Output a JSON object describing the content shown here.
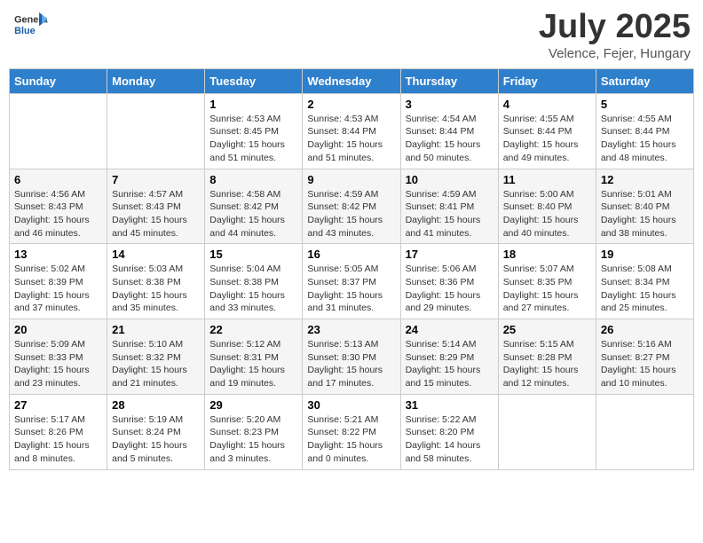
{
  "header": {
    "logo_general": "General",
    "logo_blue": "Blue",
    "title": "July 2025",
    "location": "Velence, Fejer, Hungary"
  },
  "weekdays": [
    "Sunday",
    "Monday",
    "Tuesday",
    "Wednesday",
    "Thursday",
    "Friday",
    "Saturday"
  ],
  "weeks": [
    [
      {
        "day": "",
        "sunrise": "",
        "sunset": "",
        "daylight": ""
      },
      {
        "day": "",
        "sunrise": "",
        "sunset": "",
        "daylight": ""
      },
      {
        "day": "1",
        "sunrise": "Sunrise: 4:53 AM",
        "sunset": "Sunset: 8:45 PM",
        "daylight": "Daylight: 15 hours and 51 minutes."
      },
      {
        "day": "2",
        "sunrise": "Sunrise: 4:53 AM",
        "sunset": "Sunset: 8:44 PM",
        "daylight": "Daylight: 15 hours and 51 minutes."
      },
      {
        "day": "3",
        "sunrise": "Sunrise: 4:54 AM",
        "sunset": "Sunset: 8:44 PM",
        "daylight": "Daylight: 15 hours and 50 minutes."
      },
      {
        "day": "4",
        "sunrise": "Sunrise: 4:55 AM",
        "sunset": "Sunset: 8:44 PM",
        "daylight": "Daylight: 15 hours and 49 minutes."
      },
      {
        "day": "5",
        "sunrise": "Sunrise: 4:55 AM",
        "sunset": "Sunset: 8:44 PM",
        "daylight": "Daylight: 15 hours and 48 minutes."
      }
    ],
    [
      {
        "day": "6",
        "sunrise": "Sunrise: 4:56 AM",
        "sunset": "Sunset: 8:43 PM",
        "daylight": "Daylight: 15 hours and 46 minutes."
      },
      {
        "day": "7",
        "sunrise": "Sunrise: 4:57 AM",
        "sunset": "Sunset: 8:43 PM",
        "daylight": "Daylight: 15 hours and 45 minutes."
      },
      {
        "day": "8",
        "sunrise": "Sunrise: 4:58 AM",
        "sunset": "Sunset: 8:42 PM",
        "daylight": "Daylight: 15 hours and 44 minutes."
      },
      {
        "day": "9",
        "sunrise": "Sunrise: 4:59 AM",
        "sunset": "Sunset: 8:42 PM",
        "daylight": "Daylight: 15 hours and 43 minutes."
      },
      {
        "day": "10",
        "sunrise": "Sunrise: 4:59 AM",
        "sunset": "Sunset: 8:41 PM",
        "daylight": "Daylight: 15 hours and 41 minutes."
      },
      {
        "day": "11",
        "sunrise": "Sunrise: 5:00 AM",
        "sunset": "Sunset: 8:40 PM",
        "daylight": "Daylight: 15 hours and 40 minutes."
      },
      {
        "day": "12",
        "sunrise": "Sunrise: 5:01 AM",
        "sunset": "Sunset: 8:40 PM",
        "daylight": "Daylight: 15 hours and 38 minutes."
      }
    ],
    [
      {
        "day": "13",
        "sunrise": "Sunrise: 5:02 AM",
        "sunset": "Sunset: 8:39 PM",
        "daylight": "Daylight: 15 hours and 37 minutes."
      },
      {
        "day": "14",
        "sunrise": "Sunrise: 5:03 AM",
        "sunset": "Sunset: 8:38 PM",
        "daylight": "Daylight: 15 hours and 35 minutes."
      },
      {
        "day": "15",
        "sunrise": "Sunrise: 5:04 AM",
        "sunset": "Sunset: 8:38 PM",
        "daylight": "Daylight: 15 hours and 33 minutes."
      },
      {
        "day": "16",
        "sunrise": "Sunrise: 5:05 AM",
        "sunset": "Sunset: 8:37 PM",
        "daylight": "Daylight: 15 hours and 31 minutes."
      },
      {
        "day": "17",
        "sunrise": "Sunrise: 5:06 AM",
        "sunset": "Sunset: 8:36 PM",
        "daylight": "Daylight: 15 hours and 29 minutes."
      },
      {
        "day": "18",
        "sunrise": "Sunrise: 5:07 AM",
        "sunset": "Sunset: 8:35 PM",
        "daylight": "Daylight: 15 hours and 27 minutes."
      },
      {
        "day": "19",
        "sunrise": "Sunrise: 5:08 AM",
        "sunset": "Sunset: 8:34 PM",
        "daylight": "Daylight: 15 hours and 25 minutes."
      }
    ],
    [
      {
        "day": "20",
        "sunrise": "Sunrise: 5:09 AM",
        "sunset": "Sunset: 8:33 PM",
        "daylight": "Daylight: 15 hours and 23 minutes."
      },
      {
        "day": "21",
        "sunrise": "Sunrise: 5:10 AM",
        "sunset": "Sunset: 8:32 PM",
        "daylight": "Daylight: 15 hours and 21 minutes."
      },
      {
        "day": "22",
        "sunrise": "Sunrise: 5:12 AM",
        "sunset": "Sunset: 8:31 PM",
        "daylight": "Daylight: 15 hours and 19 minutes."
      },
      {
        "day": "23",
        "sunrise": "Sunrise: 5:13 AM",
        "sunset": "Sunset: 8:30 PM",
        "daylight": "Daylight: 15 hours and 17 minutes."
      },
      {
        "day": "24",
        "sunrise": "Sunrise: 5:14 AM",
        "sunset": "Sunset: 8:29 PM",
        "daylight": "Daylight: 15 hours and 15 minutes."
      },
      {
        "day": "25",
        "sunrise": "Sunrise: 5:15 AM",
        "sunset": "Sunset: 8:28 PM",
        "daylight": "Daylight: 15 hours and 12 minutes."
      },
      {
        "day": "26",
        "sunrise": "Sunrise: 5:16 AM",
        "sunset": "Sunset: 8:27 PM",
        "daylight": "Daylight: 15 hours and 10 minutes."
      }
    ],
    [
      {
        "day": "27",
        "sunrise": "Sunrise: 5:17 AM",
        "sunset": "Sunset: 8:26 PM",
        "daylight": "Daylight: 15 hours and 8 minutes."
      },
      {
        "day": "28",
        "sunrise": "Sunrise: 5:19 AM",
        "sunset": "Sunset: 8:24 PM",
        "daylight": "Daylight: 15 hours and 5 minutes."
      },
      {
        "day": "29",
        "sunrise": "Sunrise: 5:20 AM",
        "sunset": "Sunset: 8:23 PM",
        "daylight": "Daylight: 15 hours and 3 minutes."
      },
      {
        "day": "30",
        "sunrise": "Sunrise: 5:21 AM",
        "sunset": "Sunset: 8:22 PM",
        "daylight": "Daylight: 15 hours and 0 minutes."
      },
      {
        "day": "31",
        "sunrise": "Sunrise: 5:22 AM",
        "sunset": "Sunset: 8:20 PM",
        "daylight": "Daylight: 14 hours and 58 minutes."
      },
      {
        "day": "",
        "sunrise": "",
        "sunset": "",
        "daylight": ""
      },
      {
        "day": "",
        "sunrise": "",
        "sunset": "",
        "daylight": ""
      }
    ]
  ]
}
